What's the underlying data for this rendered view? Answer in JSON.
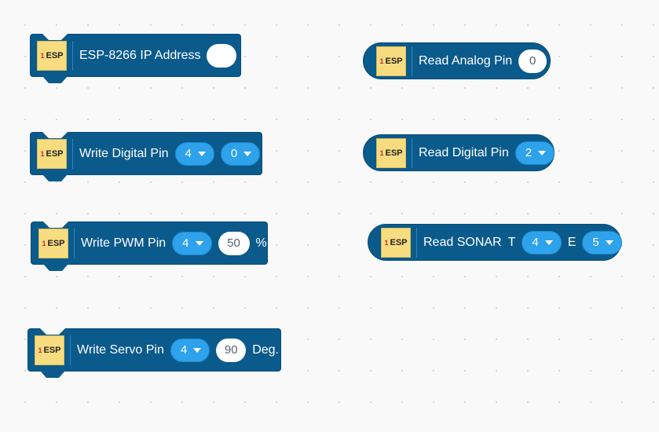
{
  "extension_icon": {
    "number": "1",
    "text": "ESP"
  },
  "blocks": {
    "ip_address": {
      "label": "ESP-8266 IP Address",
      "value": ""
    },
    "write_digital": {
      "label": "Write Digital Pin",
      "pin": "4",
      "value": "0"
    },
    "write_pwm": {
      "label": "Write PWM Pin",
      "pin": "4",
      "value": "50",
      "unit": "%"
    },
    "write_servo": {
      "label": "Write Servo Pin",
      "pin": "4",
      "value": "90",
      "unit": "Deg."
    },
    "read_analog": {
      "label": "Read Analog Pin",
      "pin": "0"
    },
    "read_digital": {
      "label": "Read Digital Pin",
      "pin": "2"
    },
    "read_sonar": {
      "label": "Read SONAR",
      "trigger_label": "T",
      "trigger_pin": "4",
      "echo_label": "E",
      "echo_pin": "5"
    }
  },
  "colors": {
    "block_bg": "#0b5a8c",
    "dropdown_bg": "#2ea2eb",
    "icon_bg": "#f7dd80",
    "workspace_bg": "#f9f9f9"
  }
}
